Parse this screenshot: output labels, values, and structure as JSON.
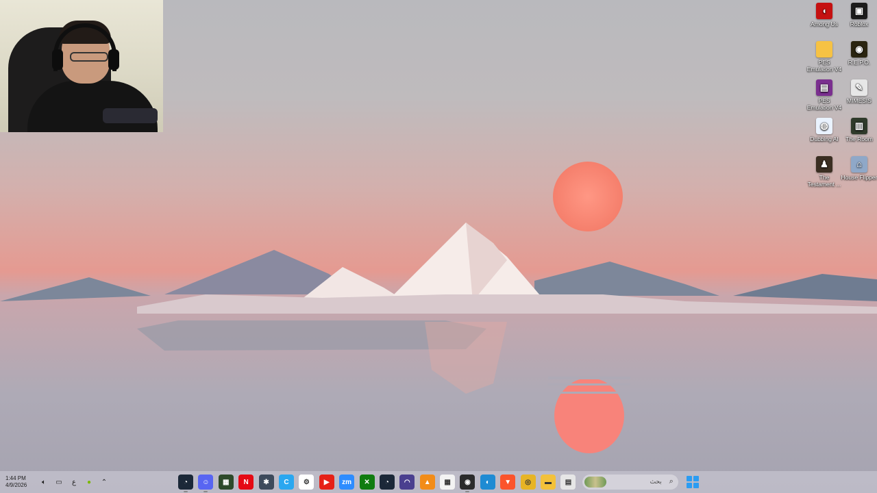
{
  "desktop": {
    "icons": [
      {
        "label": "Among Us",
        "icon": "among-us-icon",
        "color": "#c51111",
        "glyph": "◖"
      },
      {
        "label": "Roblox",
        "icon": "roblox-icon",
        "color": "#1c1c1c",
        "glyph": "▣"
      },
      {
        "label": "PES Emulation V4",
        "icon": "folder-icon",
        "color": "#f6c244",
        "glyph": ""
      },
      {
        "label": "R.E.P.O.",
        "icon": "repo-icon",
        "color": "#2a2410",
        "glyph": "◉"
      },
      {
        "label": "PES Emulation V4",
        "icon": "winrar-icon",
        "color": "#7a2f8f",
        "glyph": "▤"
      },
      {
        "label": "MIMESIS",
        "icon": "mimesis-icon",
        "color": "#e7e7e7",
        "glyph": "✎"
      },
      {
        "label": "Dubbing AI",
        "icon": "dubbing-ai-icon",
        "color": "#eaf3ff",
        "glyph": "◍"
      },
      {
        "label": "The Room",
        "icon": "the-room-icon",
        "color": "#2f3a2a",
        "glyph": "▥"
      },
      {
        "label": "The Testament ...",
        "icon": "testament-icon",
        "color": "#3a2e22",
        "glyph": "♟"
      },
      {
        "label": "House Flipper",
        "icon": "house-flipper-icon",
        "color": "#8fa8c8",
        "glyph": "⌂"
      }
    ]
  },
  "taskbar": {
    "time": "1:44 PM",
    "date": "4/9/2026",
    "language": "ع",
    "search_placeholder": "بحث",
    "apps": [
      {
        "name": "steam-icon",
        "color": "#1b2838",
        "glyph": "◔",
        "running": true
      },
      {
        "name": "discord-icon",
        "color": "#5865f2",
        "glyph": "☺",
        "running": true
      },
      {
        "name": "game-launcher-icon",
        "color": "#2d4a2b",
        "glyph": "▦",
        "running": false
      },
      {
        "name": "netflix-icon",
        "color": "#e50914",
        "glyph": "N",
        "running": false
      },
      {
        "name": "davinci-resolve-icon",
        "color": "#3d4a5c",
        "glyph": "✱",
        "running": false
      },
      {
        "name": "capcut-icon",
        "color": "#2aa7f0",
        "glyph": "C",
        "running": false
      },
      {
        "name": "steelseries-icon",
        "color": "#ffffff",
        "glyph": "⚙",
        "running": false
      },
      {
        "name": "youtube-icon",
        "color": "#e62117",
        "glyph": "▶",
        "running": false
      },
      {
        "name": "zoom-icon",
        "color": "#2d8cff",
        "glyph": "zm",
        "running": false
      },
      {
        "name": "xbox-icon",
        "color": "#107c10",
        "glyph": "✕",
        "running": false
      },
      {
        "name": "steam-icon",
        "color": "#1b2838",
        "glyph": "◔",
        "running": false
      },
      {
        "name": "headset-icon",
        "color": "#4a3f8f",
        "glyph": "◠",
        "running": false
      },
      {
        "name": "vlc-icon",
        "color": "#f28c18",
        "glyph": "▲",
        "running": false
      },
      {
        "name": "microsoft-store-icon",
        "color": "#f3f3f3",
        "glyph": "▦",
        "running": false
      },
      {
        "name": "obs-icon",
        "color": "#2b2b2b",
        "glyph": "◉",
        "running": true
      },
      {
        "name": "edge-icon",
        "color": "#1e8bd3",
        "glyph": "◐",
        "running": false
      },
      {
        "name": "brave-icon",
        "color": "#fb542b",
        "glyph": "▼",
        "running": false
      },
      {
        "name": "chrome-icon",
        "color": "#e7b425",
        "glyph": "◎",
        "running": false
      },
      {
        "name": "file-explorer-icon",
        "color": "#f3c13a",
        "glyph": "▬",
        "running": false
      },
      {
        "name": "notepad-icon",
        "color": "#e6e6e6",
        "glyph": "▤",
        "running": false
      }
    ]
  }
}
